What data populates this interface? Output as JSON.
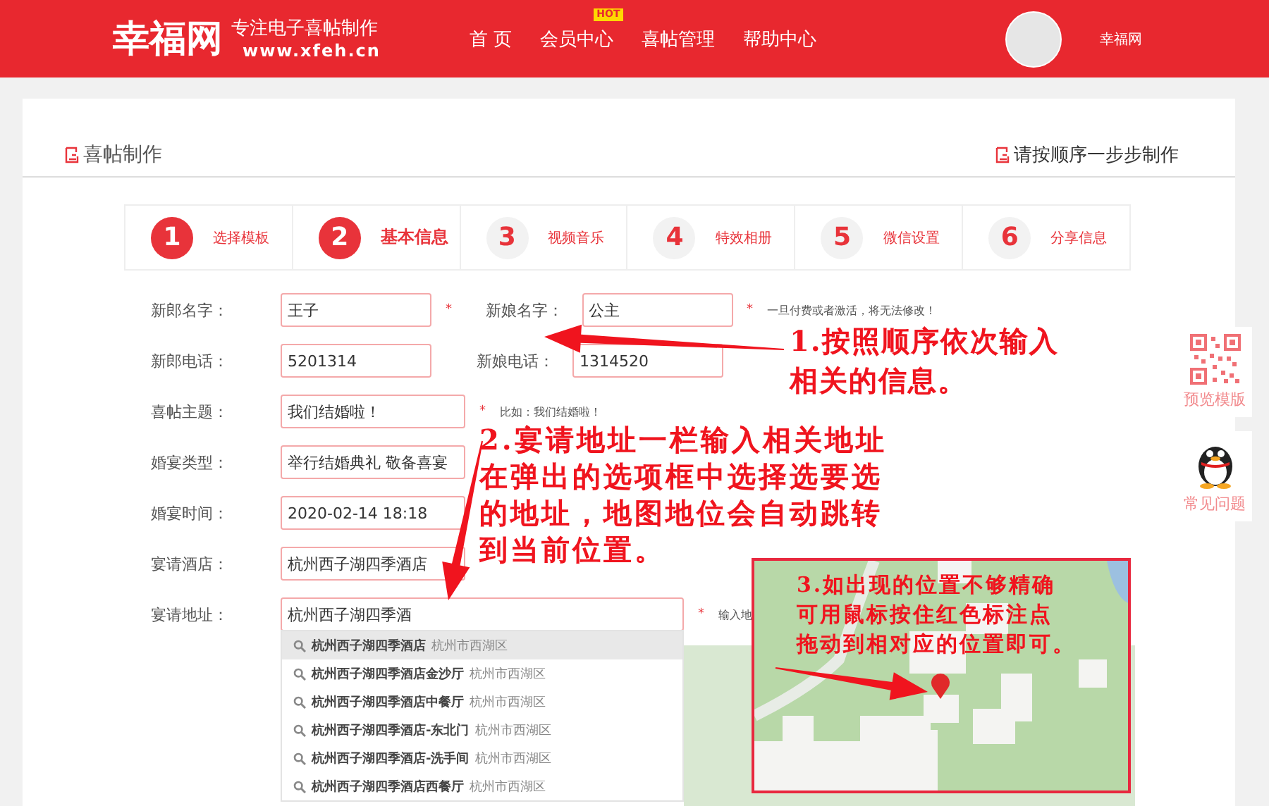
{
  "header": {
    "logo": "幸福网",
    "slogan": "专注电子喜帖制作",
    "site": "www.xfeh.cn",
    "nav": [
      {
        "label": "首 页"
      },
      {
        "label": "会员中心",
        "badge": "HOT"
      },
      {
        "label": "喜帖管理"
      },
      {
        "label": "帮助中心"
      }
    ],
    "user": "幸福网"
  },
  "panel": {
    "title": "喜帖制作",
    "guide": "请按顺序一步步制作"
  },
  "steps": [
    {
      "number": "1",
      "label": "选择模板",
      "completed": true,
      "selected": false
    },
    {
      "number": "2",
      "label": "基本信息",
      "completed": true,
      "selected": true
    },
    {
      "number": "3",
      "label": "视频音乐",
      "completed": false,
      "selected": false
    },
    {
      "number": "4",
      "label": "特效相册",
      "completed": false,
      "selected": false
    },
    {
      "number": "5",
      "label": "微信设置",
      "completed": false,
      "selected": false
    },
    {
      "number": "6",
      "label": "分享信息",
      "completed": false,
      "selected": false
    }
  ],
  "form": [
    {
      "label": "新郎名字：",
      "value": "王子",
      "mark": "*",
      "second": {
        "label": "新娘名字：",
        "value": "公主",
        "mark": "*"
      },
      "hint": "一旦付费或者激活，将无法修改！"
    },
    {
      "label": "新郎电话：",
      "value": "5201314",
      "second": {
        "label": "新娘电话：",
        "value": "1314520"
      }
    },
    {
      "label": "喜帖主题：",
      "value": "我们结婚啦！",
      "mark": "*",
      "hint": "比如：我们结婚啦！"
    },
    {
      "label": "婚宴类型：",
      "value": "举行结婚典礼 敬备喜宴"
    },
    {
      "label": "婚宴时间：",
      "value": "2020-02-14 18:18"
    },
    {
      "label": "宴请酒店：",
      "value": "杭州西子湖四季酒店"
    },
    {
      "label": "宴请地址：",
      "value": "杭州西子湖四季酒",
      "mark": "*",
      "hint": "输入地"
    }
  ],
  "suggestions": [
    {
      "name": "杭州西子湖四季酒店",
      "district": "杭州市西湖区",
      "selected": true
    },
    {
      "name": "杭州西子湖四季酒店金沙厅",
      "district": "杭州市西湖区",
      "selected": false
    },
    {
      "name": "杭州西子湖四季酒店中餐厅",
      "district": "杭州市西湖区",
      "selected": false
    },
    {
      "name": "杭州西子湖四季酒店-东北门",
      "district": "杭州市西湖区",
      "selected": false
    },
    {
      "name": "杭州西子湖四季酒店-洗手间",
      "district": "杭州市西湖区",
      "selected": false
    },
    {
      "name": "杭州西子湖四季酒店西餐厅",
      "district": "杭州市西湖区",
      "selected": false
    }
  ],
  "side": [
    {
      "kind": "qr",
      "label": "预览模版"
    },
    {
      "kind": "penguin",
      "label": "常见问题"
    }
  ],
  "annotations": [
    {
      "lines": [
        "1.按照顺序依次输入",
        "相关的信息。"
      ]
    },
    {
      "lines": [
        "2.宴请地址一栏输入相关地址",
        "在弹出的选项框中选择选要选",
        "的地址，地图地位会自动跳转",
        "到当前位置。"
      ]
    },
    {
      "lines": [
        "3.如出现的位置不够精确",
        "可用鼠标按住红色标注点",
        "拖动到相对应的位置即可。"
      ]
    }
  ]
}
